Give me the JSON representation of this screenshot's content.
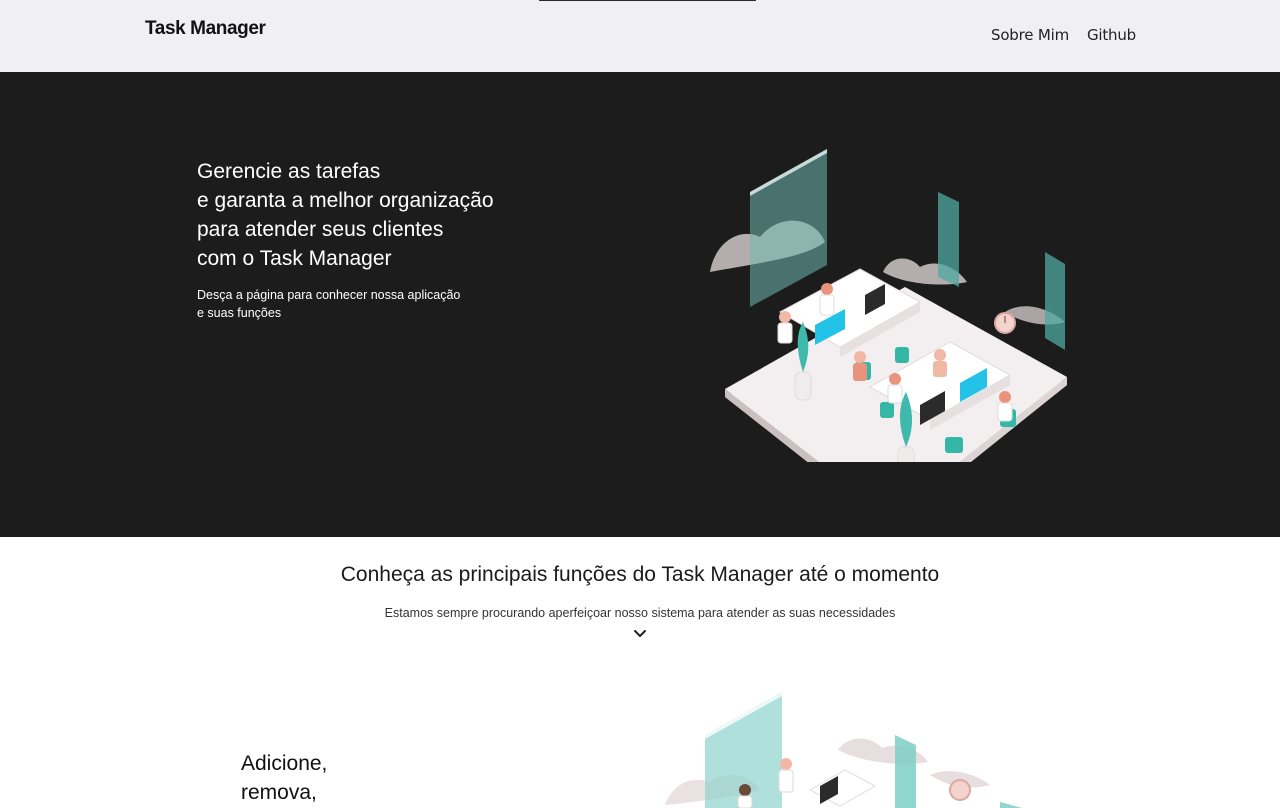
{
  "navbar": {
    "brand": "Task Manager",
    "links": [
      {
        "label": "Sobre Mim"
      },
      {
        "label": "Github"
      }
    ]
  },
  "hero": {
    "heading_lines": [
      "Gerencie as tarefas",
      "e garanta a melhor organização",
      "para atender seus clientes",
      "com o Task Manager"
    ],
    "sub_lines": [
      "Desça a página para conhecer nossa aplicação",
      "e suas funções"
    ],
    "illustration_icon": "office-workspace-illustration"
  },
  "features": {
    "title": "Conheça as principais funções do Task Manager até o momento",
    "subtitle": "Estamos sempre procurando aperfeiçoar nosso sistema para atender as suas necessidades",
    "scroll_icon": "chevron-down-icon",
    "first_feature": {
      "lines": [
        "Adicione,",
        "remova,"
      ],
      "illustration_icon": "office-workspace-illustration"
    }
  },
  "colors": {
    "navbar_bg": "#f0f0f2",
    "hero_bg": "#1c1c1d",
    "accent_teal": "#5fc4bb",
    "accent_cyan": "#22c3e6",
    "accent_pink": "#e9b7b1"
  }
}
